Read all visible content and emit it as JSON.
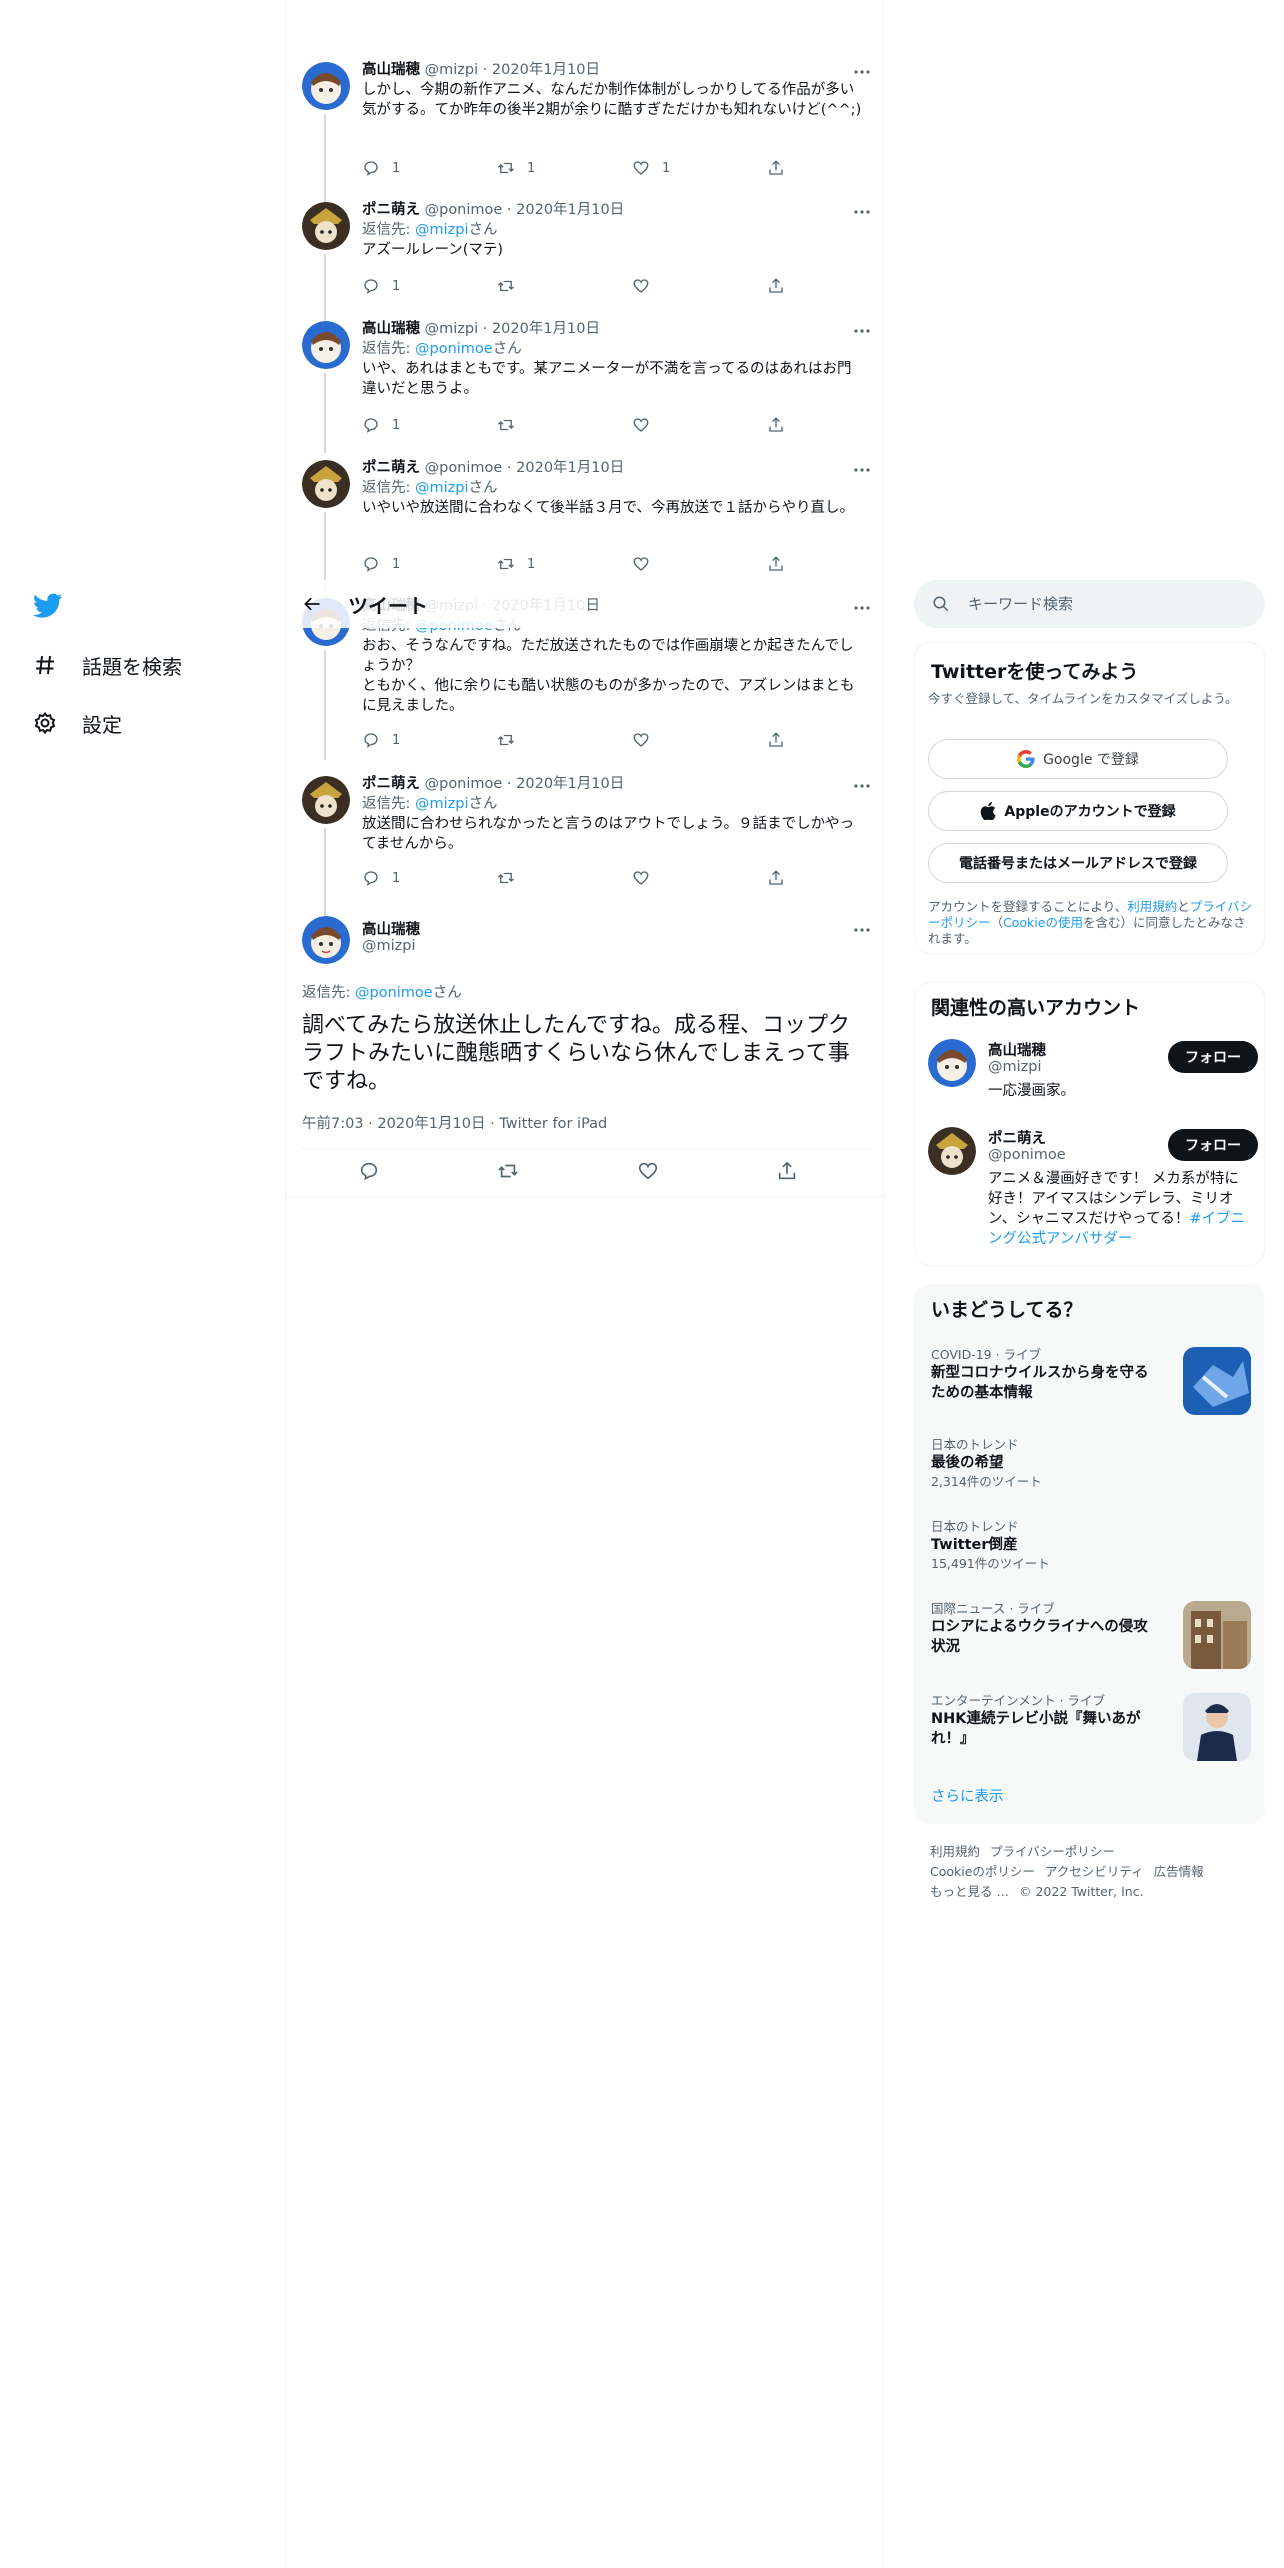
{
  "nav": {
    "explore_label": "話題を検索",
    "settings_label": "設定"
  },
  "header": {
    "title": "ツイート"
  },
  "thread": [
    {
      "name": "高山瑞穂",
      "meta": "@mizpi · 2020年1月10日",
      "reply_to": "",
      "reply_user": "",
      "text": "しかし、今期の新作アニメ、なんだか制作体制がしっかりしてる作品が多い気がする。てか昨年の後半2期が余りに酷すぎただけかも知れないけど(^^;)",
      "replies": "1",
      "retweets": "1",
      "likes": "1"
    },
    {
      "name": "ポニ萌え",
      "meta": "@ponimoe · 2020年1月10日",
      "reply_to": "返信先: ",
      "reply_user": "@mizpi",
      "reply_suffix": "さん",
      "text": "アズールレーン(マテ)",
      "replies": "1",
      "retweets": "",
      "likes": ""
    },
    {
      "name": "高山瑞穂",
      "meta": "@mizpi · 2020年1月10日",
      "reply_to": "返信先: ",
      "reply_user": "@ponimoe",
      "reply_suffix": "さん",
      "text": "いや、あれはまともです。某アニメーターが不満を言ってるのはあれはお門違いだと思うよ。",
      "replies": "1",
      "retweets": "",
      "likes": ""
    },
    {
      "name": "ポニ萌え",
      "meta": "@ponimoe · 2020年1月10日",
      "reply_to": "返信先: ",
      "reply_user": "@mizpi",
      "reply_suffix": "さん",
      "text": "いやいや放送間に合わなくて後半話３月で、今再放送で１話からやり直し。",
      "replies": "1",
      "retweets": "1",
      "likes": ""
    },
    {
      "name": "高山瑞穂",
      "meta": "@mizpi · 2020年1月10日",
      "reply_to": "返信先: ",
      "reply_user": "@ponimoe",
      "reply_suffix": "さん",
      "text": "おお、そうなんですね。ただ放送されたものでは作画崩壊とか起きたんでしょうか？\nともかく、他に余りにも酷い状態のものが多かったので、アズレンはまともに見えました。",
      "replies": "1",
      "retweets": "",
      "likes": ""
    },
    {
      "name": "ポニ萌え",
      "meta": "@ponimoe · 2020年1月10日",
      "reply_to": "返信先: ",
      "reply_user": "@mizpi",
      "reply_suffix": "さん",
      "text": "放送間に合わせられなかったと言うのはアウトでしょう。９話までしかやってませんから。",
      "replies": "1",
      "retweets": "",
      "likes": ""
    }
  ],
  "focal": {
    "name": "高山瑞穂",
    "handle": "@mizpi",
    "reply_prefix": "返信先: ",
    "reply_user": "@ponimoe",
    "reply_suffix": "さん",
    "text": "調べてみたら放送休止したんですね。成る程、コップクラフトみたいに醜態晒すくらいなら休んでしまえって事ですね。",
    "meta": "午前7:03 · 2020年1月10日 · Twitter for iPad"
  },
  "search": {
    "placeholder": "キーワード検索"
  },
  "signup": {
    "title": "Twitterを使ってみよう",
    "subtitle": "今すぐ登録して、タイムラインをカスタマイズしよう。",
    "google_label": "Google で登録",
    "apple_label": "Appleのアカウントで登録",
    "phone_label": "電話番号またはメールアドレスで登録",
    "terms_prefix": "アカウントを登録することにより、",
    "terms_link1": "利用規約",
    "terms_mid1": "と",
    "terms_link2": "プライバシーポリシー",
    "terms_mid2": "（",
    "terms_link3": "Cookieの使用",
    "terms_suffix": "を含む）に同意したとみなされます。"
  },
  "related": {
    "title": "関連性の高いアカウント",
    "follow_label": "フォロー",
    "accounts": [
      {
        "name": "高山瑞穂",
        "handle": "@mizpi",
        "bio": "一応漫画家。",
        "bio_link": ""
      },
      {
        "name": "ポニ萌え",
        "handle": "@ponimoe",
        "bio": "アニメ＆漫画好きです！ メカ系が特に好き！アイマスはシンデレラ、ミリオン、シャニマスだけやってる！",
        "bio_link": "#イブニング公式アンバサダー"
      }
    ]
  },
  "trends": {
    "title": "いまどうしてる？",
    "items": [
      {
        "context": "COVID-19 · ライブ",
        "name": "新型コロナウイルスから身を守るための基本情報",
        "count": ""
      },
      {
        "context": "日本のトレンド",
        "name": "最後の希望",
        "count": "2,314件のツイート"
      },
      {
        "context": "日本のトレンド",
        "name": "Twitter倒産",
        "count": "15,491件のツイート"
      },
      {
        "context": "国際ニュース · ライブ",
        "name": "ロシアによるウクライナへの侵攻状況",
        "count": ""
      },
      {
        "context": "エンターテインメント · ライブ",
        "name": "NHK連続テレビ小説『舞いあがれ！』",
        "count": ""
      }
    ],
    "show_more": "さらに表示"
  },
  "footer": {
    "links": [
      "利用規約",
      "プライバシーポリシー",
      "Cookieのポリシー",
      "アクセシビリティ",
      "広告情報",
      "もっと見る …"
    ],
    "copyright": "© 2022 Twitter, Inc."
  },
  "colors": {
    "accent": "#1d9bf0",
    "text": "#0f1419",
    "muted": "#536471",
    "border": "#eff3f4"
  }
}
